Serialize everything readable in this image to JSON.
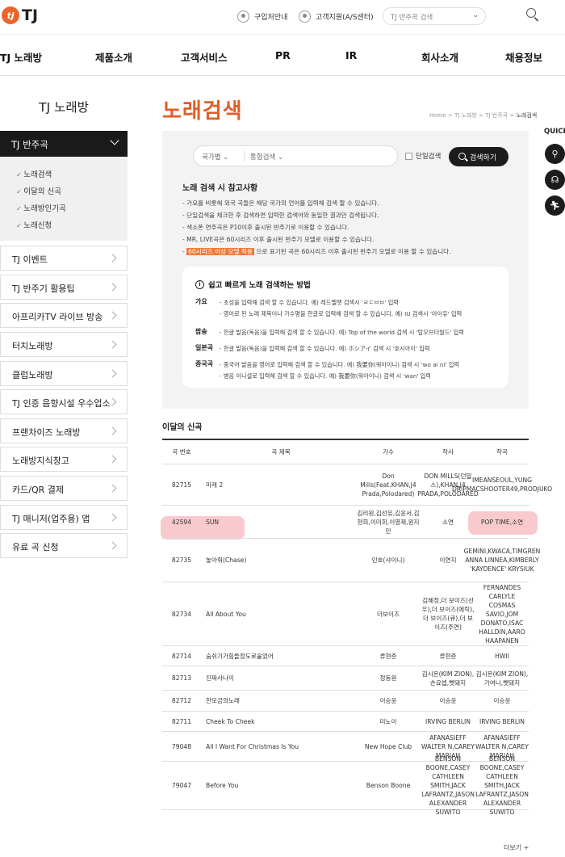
{
  "header": {
    "logo_mark": "tj",
    "logo_text": "TJ",
    "links": [
      "구입처안내",
      "고객지원(A/S센터)"
    ],
    "search_placeholder": "TJ 반주곡 검색",
    "chevron": "⌄"
  },
  "gnb": [
    "TJ 노래방",
    "제품소개",
    "고객서비스",
    "PR",
    "IR",
    "회사소개",
    "채용정보"
  ],
  "sidebar": {
    "title": "TJ 노래방",
    "active": "TJ 반주곡",
    "sub_items": [
      "노래검색",
      "이달의 신곡",
      "노래방인기곡",
      "노래신청"
    ],
    "items": [
      "TJ 이벤트",
      "TJ 반주기 활용팁",
      "아프리카TV 라이브 방송",
      "터치노래방",
      "클럽노래방",
      "TJ 인증 음향시설 우수업소",
      "프랜차이즈 노래방",
      "노래방지식창고",
      "카드/QR 결제",
      "TJ 매니저(업주용) 앱",
      "유료 곡 신청"
    ]
  },
  "main": {
    "title": "노래검색",
    "breadcrumb": [
      "Home",
      "TJ 노래방",
      "TJ 반주곡",
      "노래검색"
    ],
    "search": {
      "country": "국가별",
      "type": "통합검색",
      "single_label": "단일검색",
      "button": "검색하기"
    },
    "ref_title": "노래 검색 시 참고사항",
    "ref_lines": [
      "- 가요를 비롯해 외국 곡들은 해당 국가의 언어를 입력해 검색 할 수 있습니다.",
      "- 단일검색을 체크한 후 검색하면 입력한 검색어와 동일한 결과만 검색됩니다.",
      "- 색소폰 연주곡은 P10이후 출시된 반주기로 이용할 수 있습니다.",
      "- MR, LIVE곡은 60시리즈 이후 출시된 반주기 모델로 이용할 수 있습니다."
    ],
    "ref_last_hl": "60시리즈 이상 모델 적용",
    "ref_last_rest": " 으로 표기된 곡은 60시리즈 이후 출시된 반주기 모델로 이용 할 수 있습니다.",
    "tip_title": "쉽고 빠르게 노래 검색하는 방법",
    "tips": [
      {
        "k": "가요",
        "v": [
          "- 초성을 입력해 검색 할 수 있습니다. 예) 레드벨벳 검색시 'ㄹㄷㅂㅂ' 입력",
          "- 영어로 된 노래 제목이나 가수명을 한글로 입력해 검색 할 수 있습니다.   예) IU 검색시 '아이유' 입력"
        ]
      },
      {
        "k": "팝송",
        "v": [
          "- 한글 발음(독음)을 입력해 검색 할 수 있습니다. 예) Top of the world 검색 시 '탑오브더월드' 입력"
        ]
      },
      {
        "k": "일본곡",
        "v": [
          "- 한글 발음(독음)을 입력해 검색 할 수 있습니다. 예) ホシアイ 검색 시 '호시아이' 입력"
        ]
      },
      {
        "k": "중국곡",
        "v": [
          "- 중국어 발음을 영어로 입력해 검색 할 수 있습니다.   예) 我要你(워아이니) 검색 시 'wo ai ni' 입력",
          "- 병음 이니셜로 입력해 검색 할 수 있습니다. 예) 我要你(워아이니) 검색 시 'wan' 입력"
        ]
      }
    ],
    "new_title": "이달의 신곡",
    "table": {
      "headers": [
        "곡 번호",
        "곡 제목",
        "가수",
        "작사",
        "작곡"
      ],
      "rows": [
        [
          "82715",
          "미래 2",
          "Don Mills(Feat.KHAN,J4 Prada,Polodared)",
          "DON MILLS(던밀스),KHAN,J4 PRADA,POLODARED",
          "IMEANSEOUL,YUNG DRIPMACSHOOTER49,PRODJUKO"
        ],
        [
          "42594",
          "SUN",
          "김리원,김선유,김윤서,김현희,이미희,이영제,원지민",
          "소연",
          "POP TIME,소연"
        ],
        [
          "82735",
          "놓아줘(Chase)",
          "민호(샤이니)",
          "이연지",
          "GEMINI,KWACA,TIMGREN ANNA LINNEA,KIMBERLY 'KAYDENCE' KRYSIUK"
        ],
        [
          "82734",
          "All About You",
          "더보이즈",
          "김혜정,더 보이즈(선우),더 보이즈(에릭),더 보이즈(큐),더 보이즈(주연)",
          "FERNANDES CARLYLE COSMAS SAVIO,JOM DONATO,ISAC HALLDIN,AARO HAAPANEN"
        ],
        [
          "82714",
          "숨쉬기가힘들정도로울었어",
          "류현준",
          "류현준",
          "HWII"
        ],
        [
          "82713",
          "진짜사나이",
          "정동원",
          "김시온(KIM ZION),손요셉,뻿돼지",
          "김시온(KIM ZION),가여니,뻿돼지"
        ],
        [
          "82712",
          "한모금의노래",
          "이승윤",
          "이승윤",
          "이승윤"
        ],
        [
          "82711",
          "Cheek To Cheek",
          "미노이",
          "IRVING BERLIN",
          "IRVING BERLIN"
        ],
        [
          "79048",
          "All I Want For Christmas Is You",
          "New Hope Club",
          "AFANASIEFF WALTER N,CAREY MARIAH",
          "AFANASIEFF WALTER N,CAREY MARIAH"
        ],
        [
          "79047",
          "Before You",
          "Benson Boone",
          "BENSON BOONE,CASEY CATHLEEN SMITH,JACK LAFRANTZ,JASON ALEXANDER SUWITO",
          "BENSON BOONE,CASEY CATHLEEN SMITH,JACK LAFRANTZ,JASON ALEXANDER SUWITO"
        ]
      ]
    },
    "more": "더보기 +"
  },
  "quick": {
    "label": "QUICK",
    "icons": [
      "search-icon",
      "headset-icon",
      "run-icon"
    ]
  },
  "colors": {
    "accent": "#e05f27",
    "dark": "#1a1a1a",
    "highlight": "#f6b8bd"
  }
}
